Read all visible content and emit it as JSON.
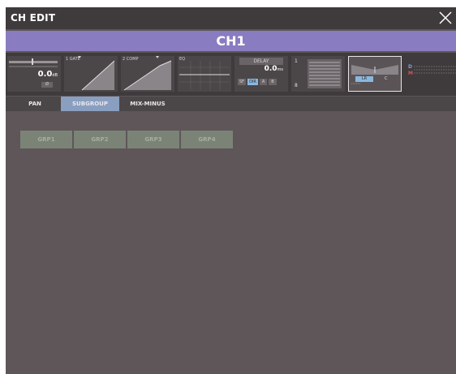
{
  "window": {
    "title": "CH EDIT"
  },
  "channel": {
    "name": "CH1"
  },
  "strip": {
    "fader": {
      "value": "0.0",
      "unit": "dB",
      "phase_label": "Ø"
    },
    "gate": {
      "label": "1 GATE"
    },
    "comp": {
      "label": "2 COMP"
    },
    "eq": {
      "label": "EQ"
    },
    "delay": {
      "label": "DELAY",
      "value": "0.0",
      "unit": "ms",
      "buttons": [
        "SF",
        "DIR",
        "A",
        "B"
      ]
    },
    "routing": {
      "top": "1",
      "bottom": "8"
    },
    "pan": {
      "left": "LR",
      "right": "C"
    },
    "meter": {
      "d": "D",
      "m": "M"
    }
  },
  "tabs": [
    {
      "label": "PAN",
      "active": false
    },
    {
      "label": "SUBGROUP",
      "active": true
    },
    {
      "label": "MIX-MINUS",
      "active": false
    }
  ],
  "groups": [
    "GRP1",
    "GRP2",
    "GRP3",
    "GRP4"
  ],
  "colors": {
    "background": "#5e5659",
    "titlebar": "#3f3a3c",
    "channel_bar": "#8a7cc0",
    "active_tab": "#8a9fc0",
    "group_button": "#7b8376",
    "meter_d": "#7aa3d8",
    "meter_m": "#d45555"
  }
}
